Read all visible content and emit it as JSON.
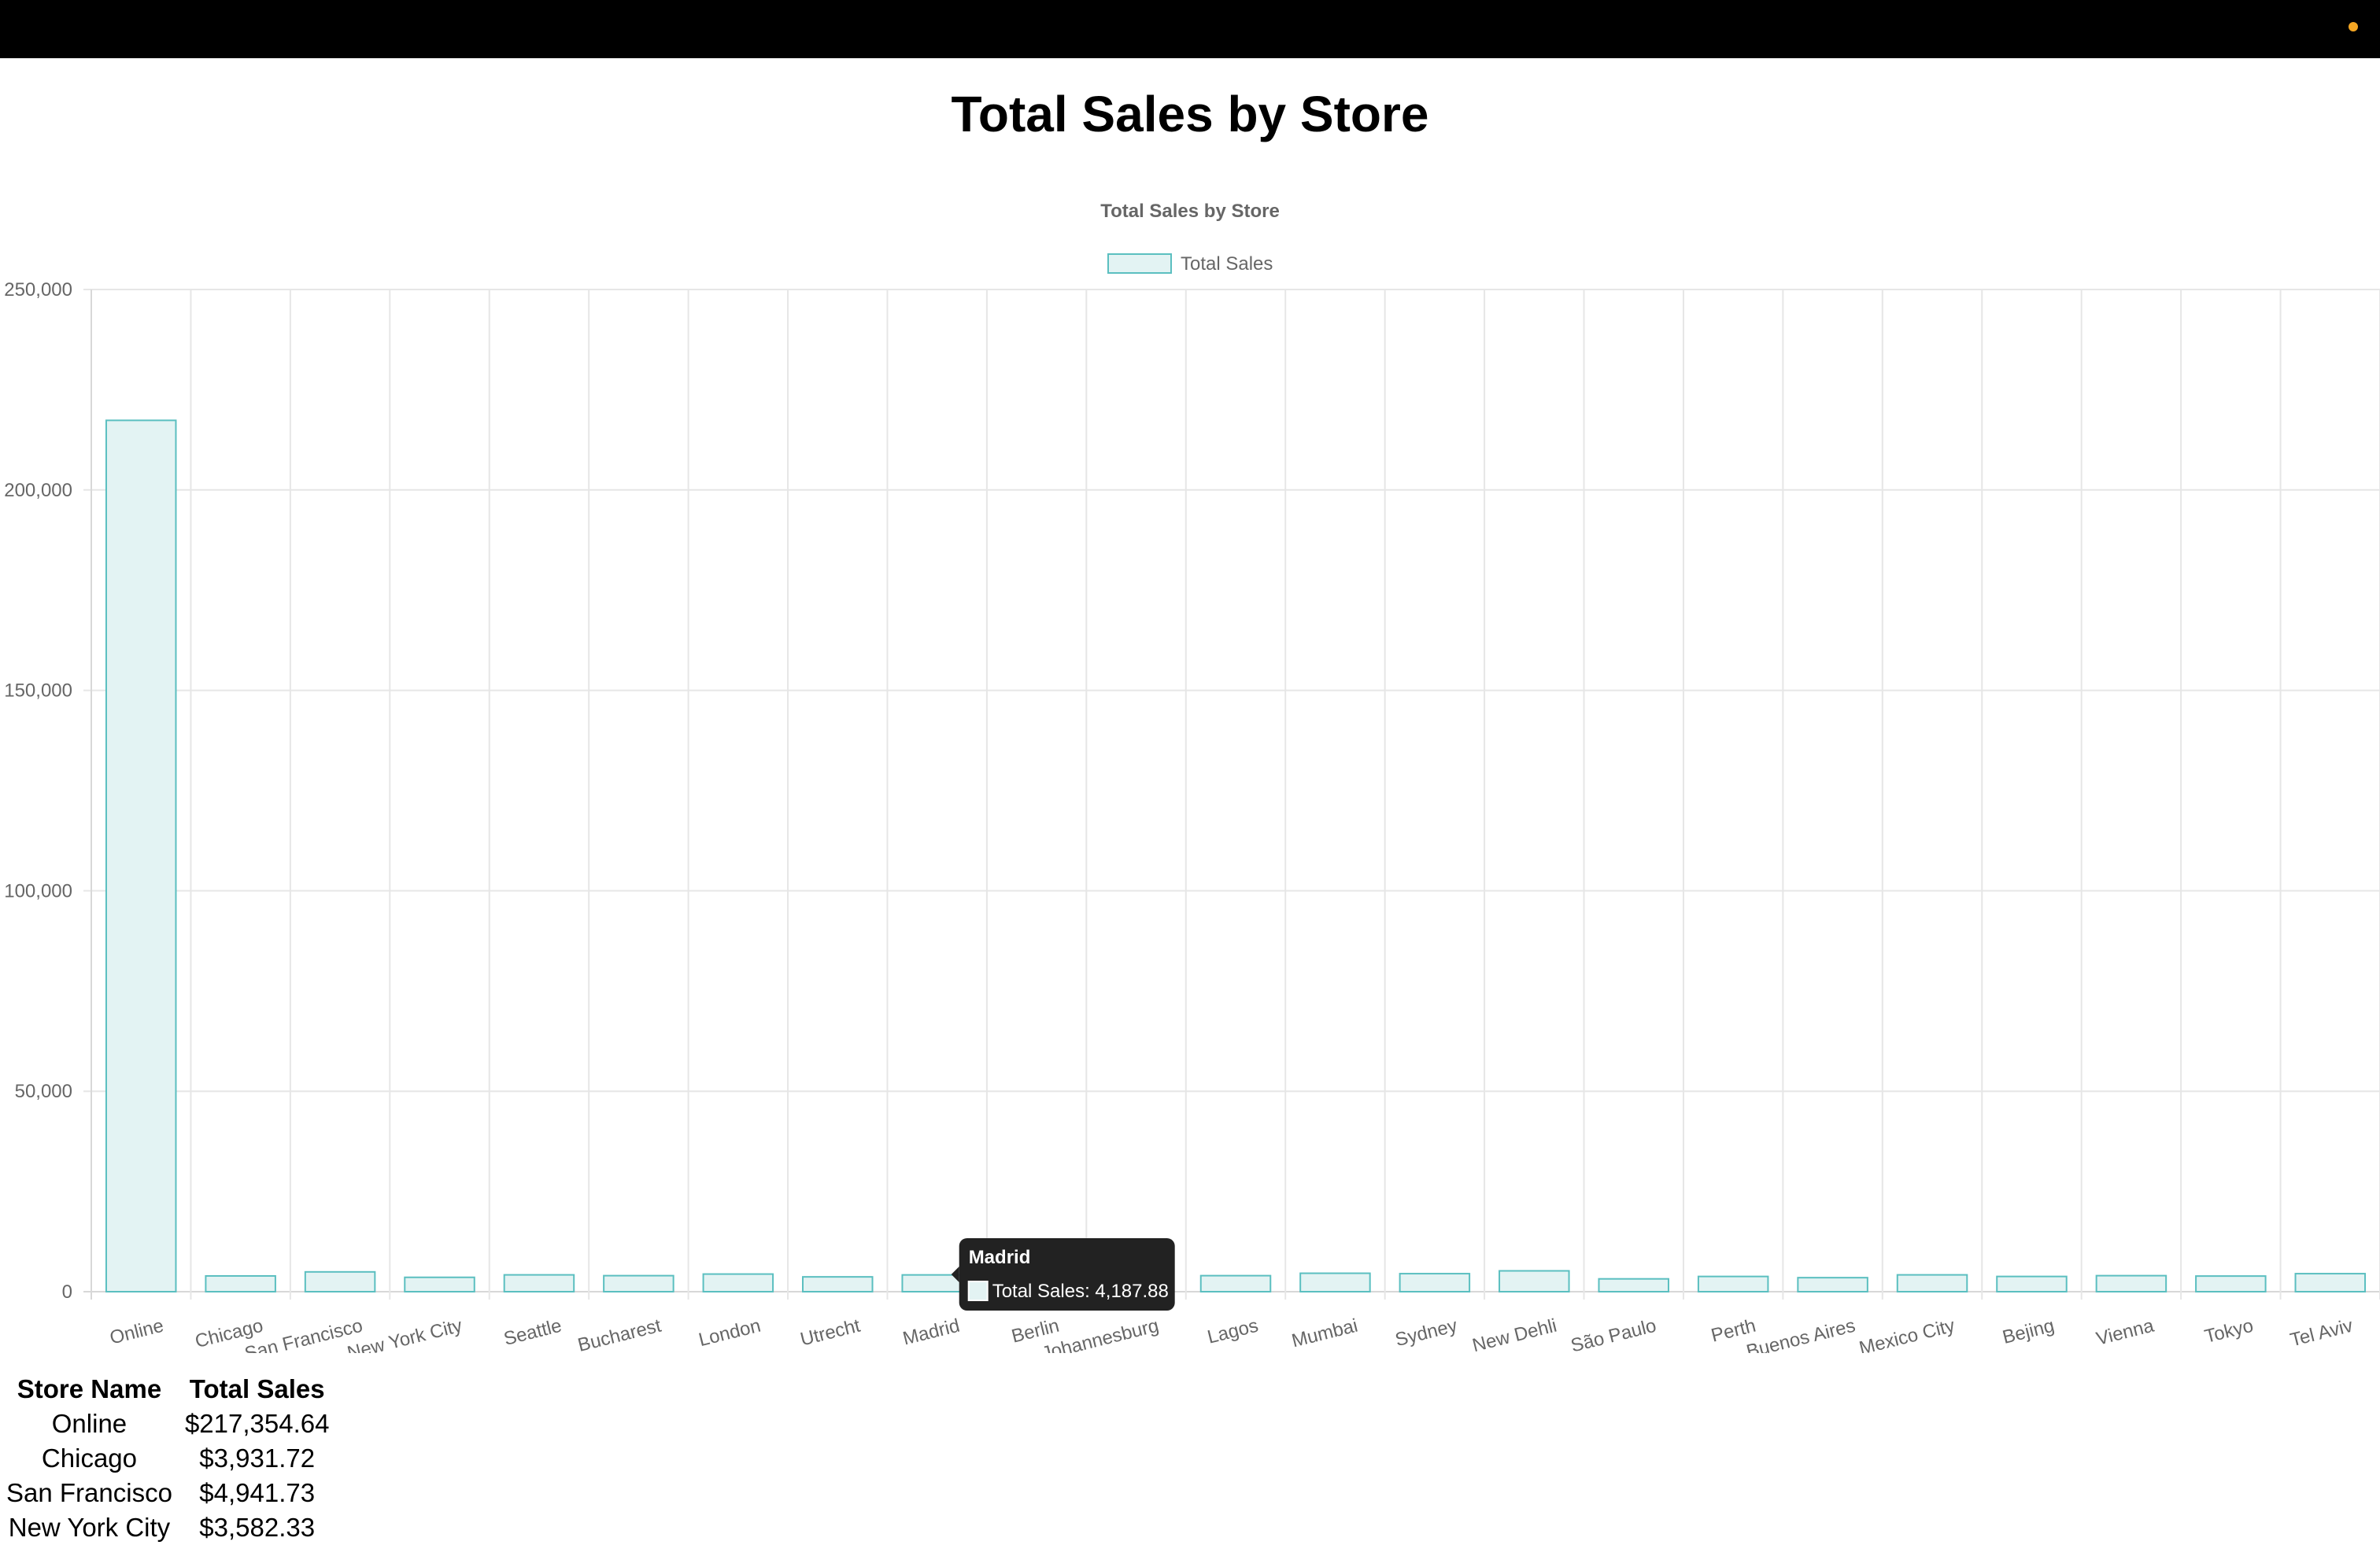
{
  "page": {
    "title": "Total Sales by Store"
  },
  "colors": {
    "bar_fill": "#e3f3f3",
    "bar_border": "#5bbfc0",
    "topbar": "#000000",
    "status_dot": "#f5a623",
    "tooltip_bg": "#222222"
  },
  "chart_data": {
    "type": "bar",
    "title": "Total Sales by Store",
    "legend": {
      "position": "top",
      "label": "Total Sales"
    },
    "categories": [
      "Online",
      "Chicago",
      "San Francisco",
      "New York City",
      "Seattle",
      "Bucharest",
      "London",
      "Utrecht",
      "Madrid",
      "Berlin",
      "Johannesburg",
      "Lagos",
      "Mumbai",
      "Sydney",
      "New Dehli",
      "São Paulo",
      "Perth",
      "Buenos Aires",
      "Mexico City",
      "Bejing",
      "Vienna",
      "Tokyo",
      "Tel Aviv"
    ],
    "series": [
      {
        "name": "Total Sales",
        "values": [
          217354.64,
          3931.72,
          4941.73,
          3582.33,
          4200,
          4000,
          4400,
          3700,
          4187.88,
          3900,
          4100,
          4000,
          4600,
          4500,
          5200,
          3200,
          3800,
          3500,
          4200,
          3800,
          4000,
          3900,
          4500
        ]
      }
    ],
    "ylim": [
      0,
      250000
    ],
    "yticks": [
      "0",
      "50,000",
      "100,000",
      "150,000",
      "200,000",
      "250,000"
    ],
    "xlabel": "",
    "ylabel": "",
    "grid": true,
    "tooltip": {
      "category": "Madrid",
      "text": "Total Sales: 4,187.88"
    }
  },
  "table": {
    "headers": [
      "Store Name",
      "Total Sales"
    ],
    "rows": [
      [
        "Online",
        "$217,354.64"
      ],
      [
        "Chicago",
        "$3,931.72"
      ],
      [
        "San Francisco",
        "$4,941.73"
      ],
      [
        "New York City",
        "$3,582.33"
      ]
    ]
  }
}
